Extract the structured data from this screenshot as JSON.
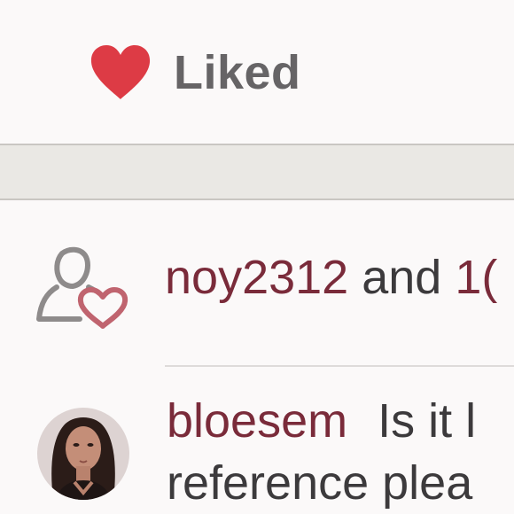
{
  "like_bar": {
    "icon": "heart-icon",
    "label": "Liked",
    "heart_color": "#dd3b45"
  },
  "likes": {
    "icon": "likers-icon",
    "first_user": "noy2312",
    "connector": "and",
    "count_visible": "1("
  },
  "comment": {
    "author": "bloesem",
    "text_line1": "Is it l",
    "text_line2": "reference plea"
  },
  "colors": {
    "accent": "#7a2b3a",
    "text": "#3c3a3c",
    "label_gray": "#666466",
    "band": "#eae8e4"
  }
}
